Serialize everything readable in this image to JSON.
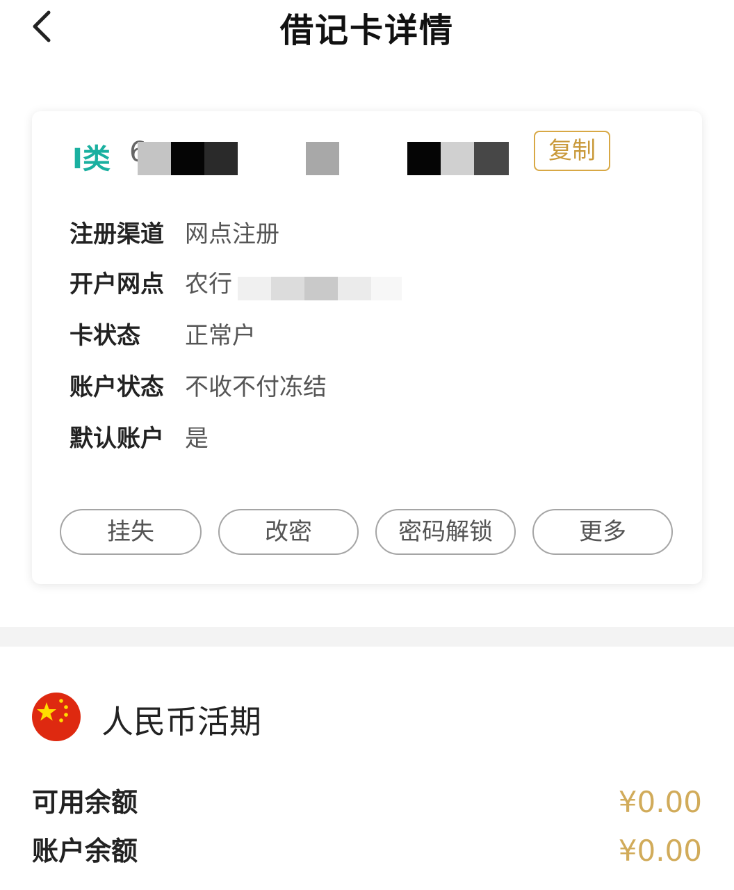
{
  "header": {
    "title": "借记卡详情",
    "back_icon": "chevron-left-icon"
  },
  "card": {
    "type": "Ⅰ类",
    "number_visible": "6",
    "copy_label": "复制",
    "rows": [
      {
        "label": "注册渠道",
        "value": "网点注册"
      },
      {
        "label": "开户网点",
        "value": "农行"
      },
      {
        "label": "卡状态",
        "value": "正常户"
      },
      {
        "label": "账户状态",
        "value": "不收不付冻结"
      },
      {
        "label": "默认账户",
        "value": "是"
      }
    ],
    "actions": [
      "挂失",
      "改密",
      "密码解锁",
      "更多"
    ]
  },
  "account": {
    "currency_title": "人民币活期",
    "flag_icon": "china-flag-icon",
    "balances": [
      {
        "label": "可用余额",
        "value": "¥0.00"
      },
      {
        "label": "账户余额",
        "value": "¥0.00"
      }
    ]
  },
  "colors": {
    "accent_teal": "#1ab0a0",
    "gold": "#d1ab5a",
    "button_border": "#a5a5a5"
  }
}
